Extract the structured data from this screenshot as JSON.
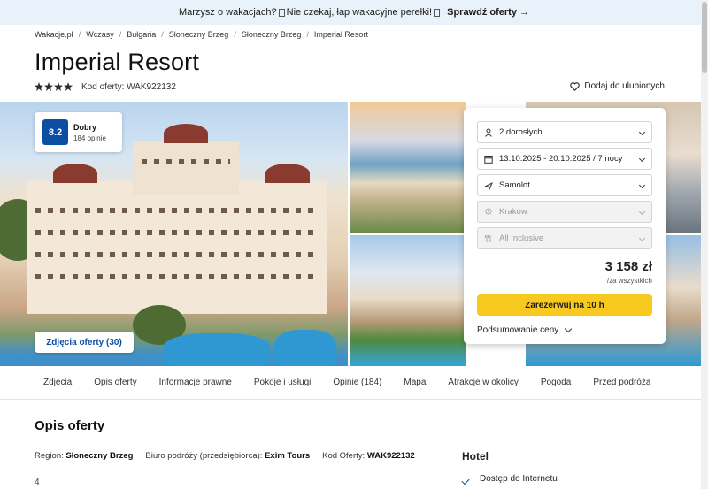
{
  "promo": {
    "text": "Marzysz o wakacjach?",
    "text2": " Nie czekaj, łap wakacyjne perełki!",
    "link": "Sprawdź oferty →"
  },
  "breadcrumb": [
    "Wakacje.pl",
    "Wczasy",
    "Bułgaria",
    "Słoneczny Brzeg",
    "Słoneczny Brzeg",
    "Imperial Resort"
  ],
  "hotel": {
    "name": "Imperial Resort",
    "stars": 4,
    "offer_code_label": "Kod oferty: WAK922132",
    "favorite_label": "Dodaj do ulubionych"
  },
  "rating": {
    "score": "8.2",
    "label": "Dobry",
    "count": "184 opinie"
  },
  "photos_button": "Zdjęcia oferty (30)",
  "booking": {
    "travelers": "2 dorosłych",
    "dates": "13.10.2025 - 20.10.2025 / 7 nocy",
    "transport": "Samolot",
    "departure": "Kraków",
    "board": "All Inclusive",
    "price": "3 158 zł",
    "price_note": "/za wszystkich",
    "reserve_label": "Zarezerwuj na 10 h",
    "summary_label": "Podsumowanie ceny"
  },
  "tabs": [
    "Zdjęcia",
    "Opis oferty",
    "Informacje prawne",
    "Pokoje i usługi",
    "Opinie (184)",
    "Mapa",
    "Atrakcje w okolicy",
    "Pogoda",
    "Przed podróżą"
  ],
  "description": {
    "title": "Opis oferty",
    "region_label": "Region:",
    "region_value": "Słoneczny Brzeg",
    "agency_label": "Biuro podróży (przedsiębiorca):",
    "agency_value": "Exim Tours",
    "code_label": "Kod Oferty:",
    "code_value": "WAK922132",
    "number": "4"
  },
  "hotel_section": {
    "title": "Hotel",
    "feature_1": "Dostęp do Internetu"
  },
  "colors": {
    "brand_blue": "#0b4ea2",
    "accent_yellow": "#f8c91e",
    "promo_bg": "#e9f1fb"
  }
}
